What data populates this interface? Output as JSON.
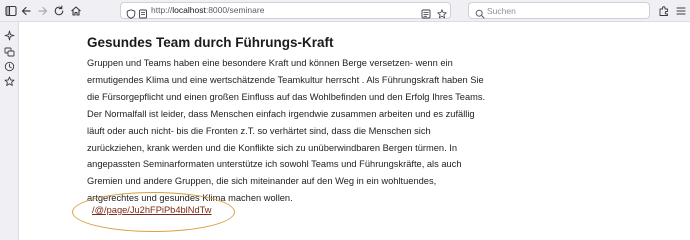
{
  "browser": {
    "url_prefix": "http://",
    "url_host": "localhost",
    "url_rest": ":8000/seminare",
    "search_placeholder": "Suchen"
  },
  "icons": {
    "sidebar_toggle": "sidebar-toggle-icon",
    "back": "back-arrow-icon",
    "forward": "forward-arrow-icon",
    "reload": "reload-icon",
    "home": "home-icon",
    "page_info": "page-info-icon",
    "tracking": "tracking-protection-icon",
    "reader": "reader-view-icon",
    "bookmark": "bookmark-star-icon",
    "search": "search-icon",
    "extension": "extension-icon",
    "menu": "menu-icon",
    "ai": "sparkle-icon",
    "tabs": "synced-tabs-icon",
    "history": "history-icon",
    "bookmarks": "bookmarks-star-icon"
  },
  "article": {
    "title": "Gesundes Team durch Führungs-Kraft",
    "lines": [
      "Gruppen und Teams haben eine besondere Kraft und können Berge versetzen- wenn ein",
      "ermutigendes Klima und eine wertschätzende Teamkultur herrscht . Als Führungskraft haben Sie",
      "die Fürsorgepflicht und einen großen Einfluss auf das Wohlbefinden und den Erfolg Ihres Teams.",
      "Der Normalfall ist leider, dass Menschen einfach irgendwie zusammen arbeiten und es zufällig",
      "läuft oder auch nicht- bis die Fronten z.T. so verhärtet sind, dass die Menschen sich",
      "zurückziehen, krank werden und die Konflikte sich zu unüberwindbaren Bergen türmen. In",
      "angepassten Seminarformaten unterstütze ich sowohl Teams und Führungskräfte, als auch",
      "Gremien und andere Gruppen, die sich miteinander auf den Weg in ein wohltuendes,",
      "artgerechtes und gesundes Klima machen wollen."
    ],
    "link_text": "/@/page/Ju2hFPiPb4blNdTw"
  },
  "colors": {
    "link": "#7a2a16",
    "highlight_ellipse": "#d8a040"
  }
}
